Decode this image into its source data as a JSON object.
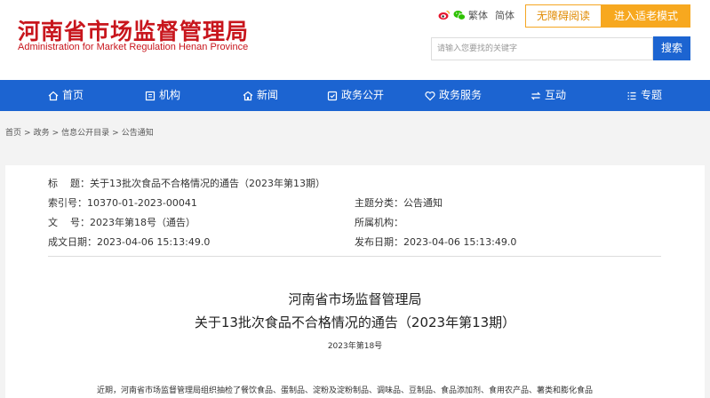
{
  "header": {
    "logo_cn": "河南省市场监督管理局",
    "logo_en": "Administration for Market Regulation Henan Province",
    "lang_traditional": "繁体",
    "lang_simplified": "简体",
    "accessible_reading": "无障碍阅读",
    "elder_mode": "进入适老模式",
    "search_placeholder": "请输入您要找的关键字",
    "search_button": "搜索"
  },
  "nav": {
    "items": [
      {
        "label": "首页",
        "icon": "home-icon"
      },
      {
        "label": "机构",
        "icon": "org-icon"
      },
      {
        "label": "新闻",
        "icon": "news-icon"
      },
      {
        "label": "政务公开",
        "icon": "open-gov-icon"
      },
      {
        "label": "政务服务",
        "icon": "heart-icon"
      },
      {
        "label": "互动",
        "icon": "interact-icon"
      },
      {
        "label": "专题",
        "icon": "topic-icon"
      }
    ]
  },
  "breadcrumb": [
    "首页",
    ">",
    "政务",
    ">",
    "信息公开目录",
    ">",
    "公告通知"
  ],
  "meta": {
    "title_label": "标    题：",
    "title_value": "关于13批次食品不合格情况的通告（2023年第13期）",
    "index_label": "索引号：",
    "index_value": "10370-01-2023-00041",
    "category_label": "主题分类：",
    "category_value": "公告通知",
    "docno_label": "文    号：",
    "docno_value": "2023年第18号（通告）",
    "org_label": "所属机构：",
    "org_value": "",
    "created_label": "成文日期：",
    "created_value": "2023-04-06 15:13:49.0",
    "published_label": "发布日期：",
    "published_value": "2023-04-06 15:13:49.0"
  },
  "document": {
    "issuer": "河南省市场监督管理局",
    "title": "关于13批次食品不合格情况的通告（2023年第13期）",
    "number": "2023年第18号",
    "body_first_line": "近期，河南省市场监督管理局组织抽检了餐饮食品、蛋制品、淀粉及淀粉制品、调味品、豆制品、食品添加剂、食用农产品、薯类和膨化食品"
  }
}
